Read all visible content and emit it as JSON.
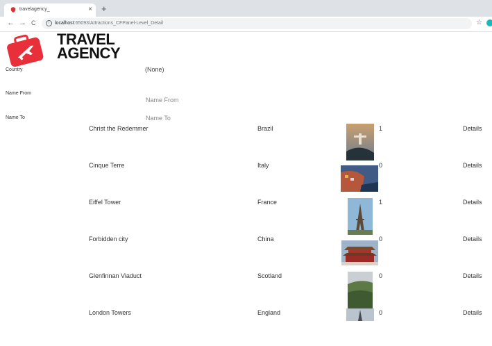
{
  "browser": {
    "tab_title": "travelagency_",
    "tab_close": "×",
    "new_tab": "+",
    "back": "←",
    "forward": "→",
    "reload": "C",
    "url_host": "localhost",
    "url_path": ":65093/Attractions_CFPanel-Level_Detail",
    "star": "☆"
  },
  "brand": {
    "line1": "TRAVEL",
    "line2": "AGENCY"
  },
  "filters": {
    "country_label": "Country",
    "country_value": "(None)",
    "name_from_label": "Name From",
    "name_from_placeholder": "Name From",
    "name_to_label": "Name To",
    "name_to_placeholder": "Name To"
  },
  "rows": [
    {
      "name": "Christ the Redemmer",
      "country": "Brazil",
      "count": "1",
      "details": "Details"
    },
    {
      "name": "Cinque Terre",
      "country": "Italy",
      "count": "0",
      "details": "Details"
    },
    {
      "name": "Eiffel Tower",
      "country": "France",
      "count": "1",
      "details": "Details"
    },
    {
      "name": "Forbidden city",
      "country": "China",
      "count": "0",
      "details": "Details"
    },
    {
      "name": "Glenfinnan Viaduct",
      "country": "Scotland",
      "count": "0",
      "details": "Details"
    },
    {
      "name": "London Towers",
      "country": "England",
      "count": "0",
      "details": "Details"
    }
  ],
  "colors": {
    "brand_red": "#e8303a",
    "tab_bg": "#dee1e6"
  }
}
